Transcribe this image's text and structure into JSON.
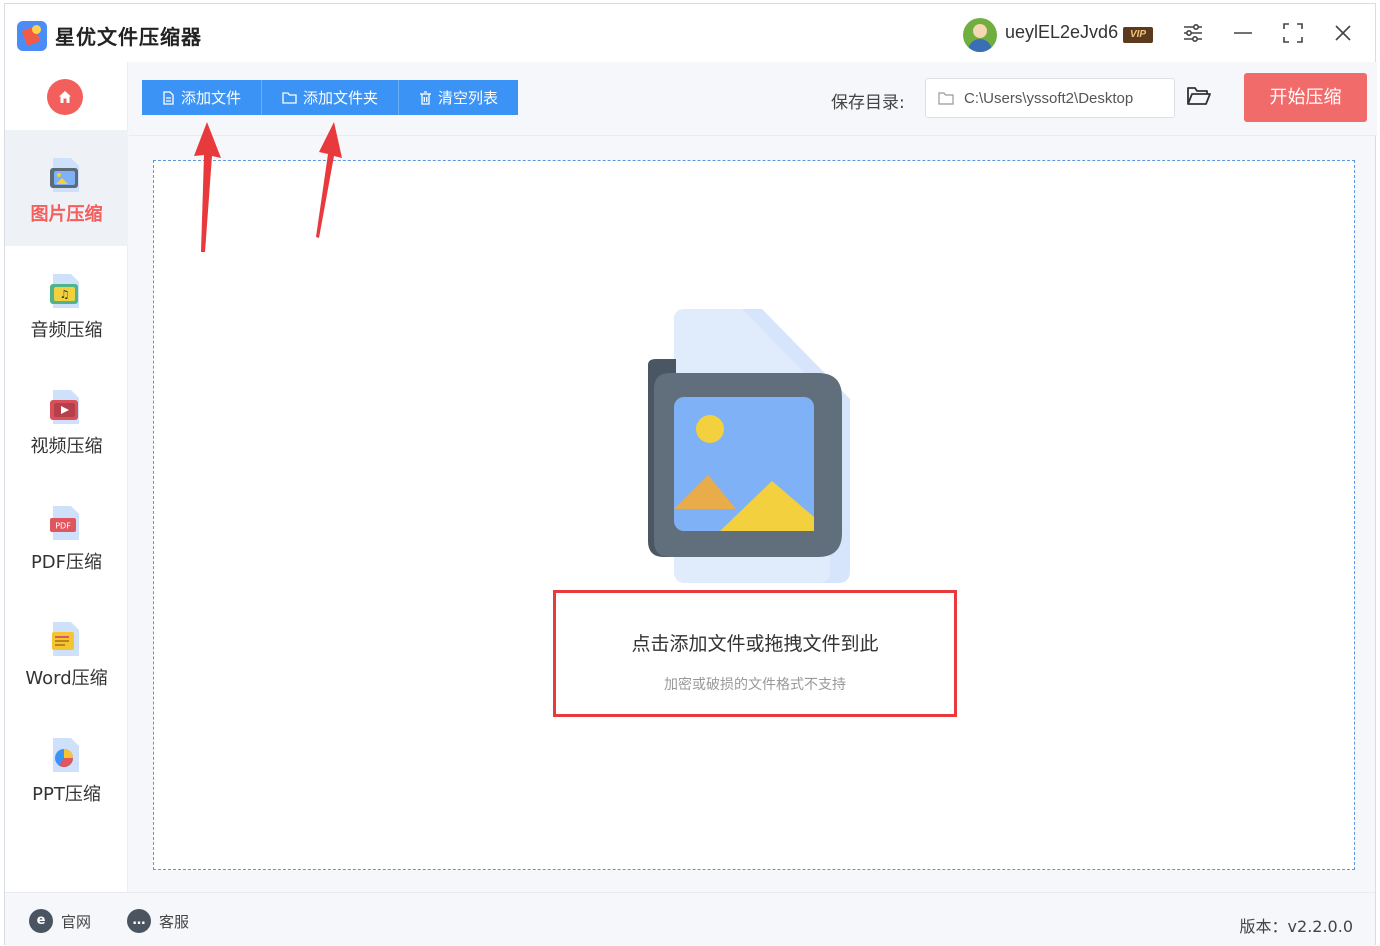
{
  "app": {
    "title": "星优文件压缩器"
  },
  "user": {
    "name": "ueylEL2eJvd6",
    "badge": "VIP"
  },
  "sidebar": {
    "items": [
      {
        "label": "图片压缩",
        "icon": "image-file-icon",
        "active": true
      },
      {
        "label": "音频压缩",
        "icon": "audio-file-icon",
        "active": false
      },
      {
        "label": "视频压缩",
        "icon": "video-file-icon",
        "active": false
      },
      {
        "label": "PDF压缩",
        "icon": "pdf-file-icon",
        "active": false
      },
      {
        "label": "Word压缩",
        "icon": "word-file-icon",
        "active": false
      },
      {
        "label": "PPT压缩",
        "icon": "ppt-file-icon",
        "active": false
      }
    ]
  },
  "toolbar": {
    "add_file": "添加文件",
    "add_folder": "添加文件夹",
    "clear_list": "清空列表",
    "save_label": "保存目录:",
    "save_path": "C:\\Users\\yssoft2\\Desktop",
    "start": "开始压缩"
  },
  "dropzone": {
    "main_hint": "点击添加文件或拖拽文件到此",
    "sub_hint": "加密或破损的文件格式不支持"
  },
  "footer": {
    "website": "官网",
    "support": "客服",
    "version": "版本：v2.2.0.0"
  },
  "colors": {
    "accent_blue": "#3a93f5",
    "accent_red": "#f26b6b",
    "annotation_red": "#e8393d"
  }
}
